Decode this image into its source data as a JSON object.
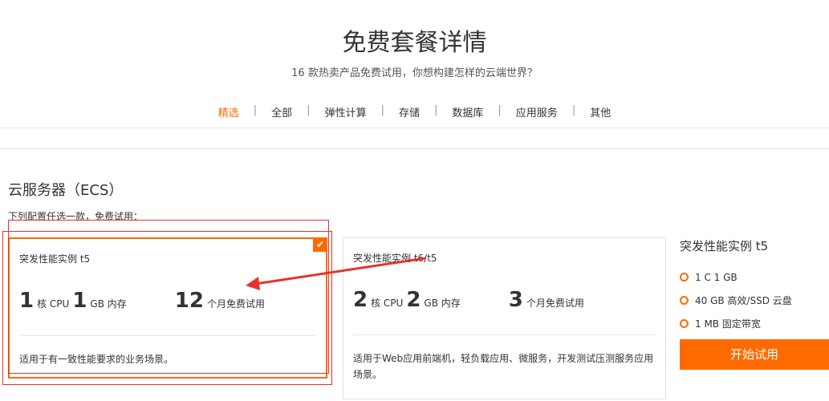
{
  "header": {
    "title": "免费套餐详情",
    "subtitle": "16 款热卖产品免费试用，你想构建怎样的云端世界？"
  },
  "tabs": [
    {
      "label": "精选",
      "active": true
    },
    {
      "label": "全部",
      "active": false
    },
    {
      "label": "弹性计算",
      "active": false
    },
    {
      "label": "存储",
      "active": false
    },
    {
      "label": "数据库",
      "active": false
    },
    {
      "label": "应用服务",
      "active": false
    },
    {
      "label": "其他",
      "active": false
    }
  ],
  "tab_separator": "|",
  "section": {
    "title": "云服务器（ECS）",
    "hint": "下列配置任选一款，免费试用："
  },
  "cards": [
    {
      "title": "突发性能实例 t5",
      "cpu": "1",
      "cpu_unit": "核 CPU",
      "mem": "1",
      "mem_unit": "GB 内存",
      "trial": "12",
      "trial_unit": "个月免费试用",
      "desc": "适用于有一致性能要求的业务场景。",
      "selected": true
    },
    {
      "title": "突发性能实例 t6/t5",
      "cpu": "2",
      "cpu_unit": "核 CPU",
      "mem": "2",
      "mem_unit": "GB 内存",
      "trial": "3",
      "trial_unit": "个月免费试用",
      "desc": "适用于Web应用前端机，轻负载应用、微服务，开发测试压测服务应用场景。",
      "selected": false
    }
  ],
  "side": {
    "title": "突发性能实例 t5",
    "items": [
      "1 C 1 GB",
      "40 GB 高效/SSD 云盘",
      "1 MB 固定带宽"
    ],
    "button": "开始试用"
  },
  "check_glyph": "✔",
  "colors": {
    "accent": "#ff6a00",
    "annotation": "#e8312c"
  }
}
